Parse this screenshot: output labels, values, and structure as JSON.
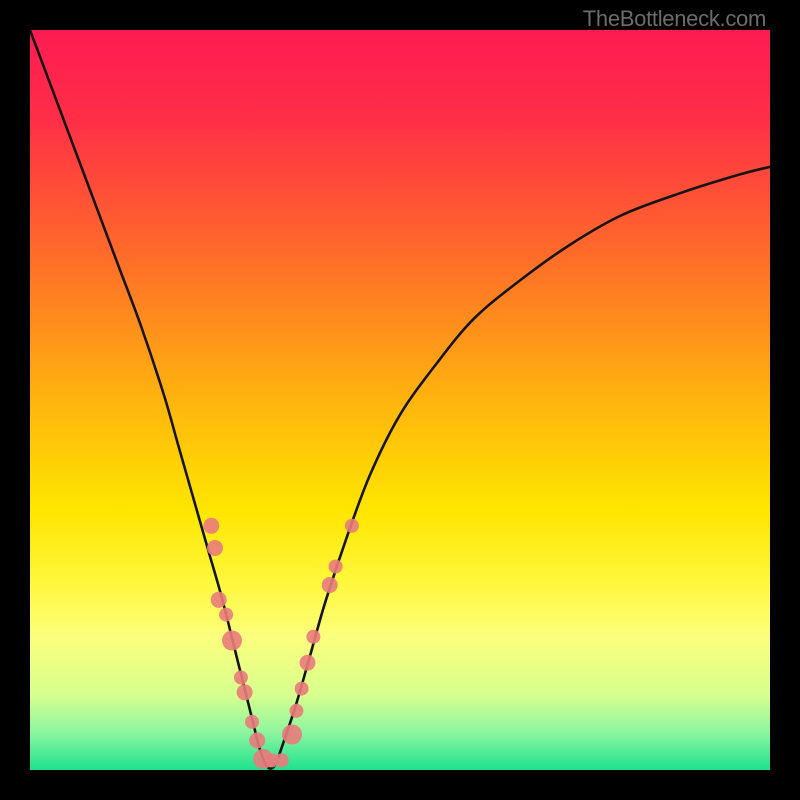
{
  "watermark": "TheBottleneck.com",
  "colors": {
    "bg": "#000000",
    "curve": "#151515",
    "dot": "#e97b7b",
    "gradient_stops": [
      {
        "offset": 0.0,
        "color": "#ff1b52"
      },
      {
        "offset": 0.12,
        "color": "#ff2e47"
      },
      {
        "offset": 0.3,
        "color": "#ff6a2a"
      },
      {
        "offset": 0.5,
        "color": "#ffb40e"
      },
      {
        "offset": 0.65,
        "color": "#ffe600"
      },
      {
        "offset": 0.75,
        "color": "#fff83f"
      },
      {
        "offset": 0.82,
        "color": "#fcff7d"
      },
      {
        "offset": 0.9,
        "color": "#d6ff8e"
      },
      {
        "offset": 0.95,
        "color": "#8bf5a0"
      },
      {
        "offset": 1.0,
        "color": "#1de28e"
      }
    ]
  },
  "chart_data": {
    "type": "line",
    "title": "",
    "xlabel": "",
    "ylabel": "",
    "xlim": [
      0,
      100
    ],
    "ylim": [
      0,
      100
    ],
    "series": [
      {
        "name": "bottleneck-curve",
        "x": [
          0,
          3,
          6,
          9,
          12,
          15,
          18,
          20,
          22,
          24,
          26,
          28,
          30,
          31,
          32,
          33,
          34,
          36,
          38,
          40,
          43,
          46,
          50,
          55,
          60,
          66,
          73,
          80,
          88,
          96,
          100
        ],
        "y": [
          100,
          92,
          84,
          76,
          68,
          60,
          51,
          44,
          37,
          30,
          23,
          15,
          7,
          3,
          0.5,
          0.5,
          3,
          9,
          16,
          23,
          32,
          40,
          48,
          55,
          61,
          66,
          71,
          75,
          78,
          80.5,
          81.5
        ]
      }
    ],
    "scatter": [
      {
        "x": 24.5,
        "y": 33,
        "r": 8
      },
      {
        "x": 25.0,
        "y": 30,
        "r": 8
      },
      {
        "x": 25.5,
        "y": 23,
        "r": 8
      },
      {
        "x": 26.5,
        "y": 21,
        "r": 7
      },
      {
        "x": 27.3,
        "y": 17.5,
        "r": 10
      },
      {
        "x": 28.5,
        "y": 12.5,
        "r": 7
      },
      {
        "x": 29.0,
        "y": 10.5,
        "r": 8
      },
      {
        "x": 30.0,
        "y": 6.5,
        "r": 7
      },
      {
        "x": 30.7,
        "y": 4.0,
        "r": 8
      },
      {
        "x": 31.5,
        "y": 1.5,
        "r": 10
      },
      {
        "x": 32.7,
        "y": 1.3,
        "r": 7
      },
      {
        "x": 34.0,
        "y": 1.3,
        "r": 7
      },
      {
        "x": 35.4,
        "y": 4.8,
        "r": 10
      },
      {
        "x": 36.0,
        "y": 8.0,
        "r": 7
      },
      {
        "x": 36.7,
        "y": 11.0,
        "r": 7
      },
      {
        "x": 37.5,
        "y": 14.5,
        "r": 8
      },
      {
        "x": 38.3,
        "y": 18.0,
        "r": 7
      },
      {
        "x": 40.5,
        "y": 25.0,
        "r": 8
      },
      {
        "x": 41.3,
        "y": 27.5,
        "r": 7
      },
      {
        "x": 43.5,
        "y": 33.0,
        "r": 7
      }
    ]
  }
}
